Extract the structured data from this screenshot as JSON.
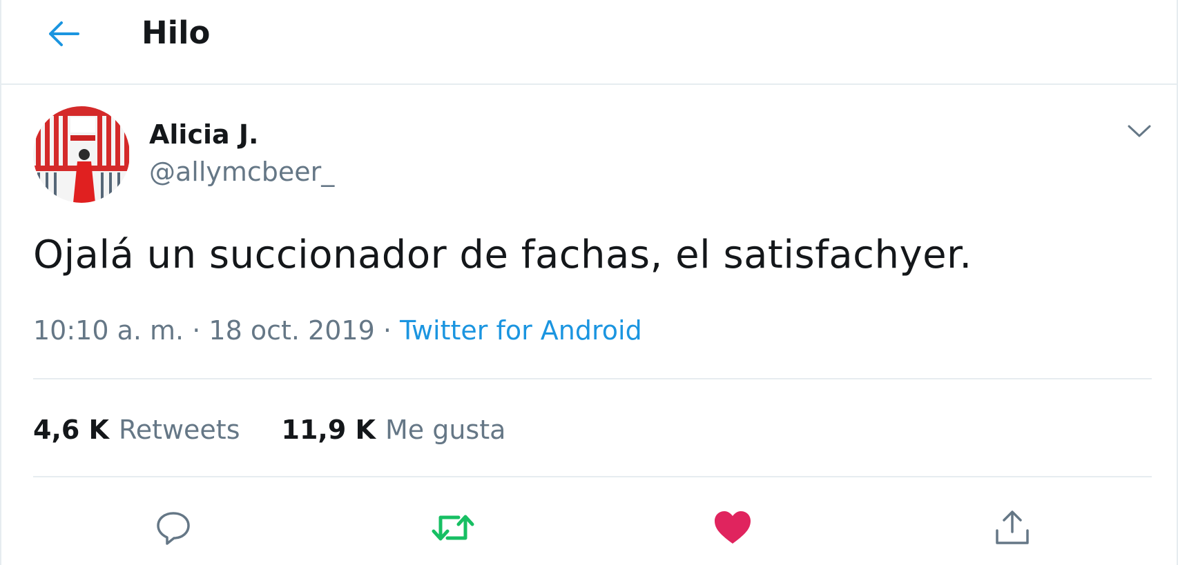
{
  "header": {
    "back_icon": "arrow-left-icon",
    "title": "Hilo"
  },
  "tweet": {
    "author": {
      "name": "Alicia J.",
      "handle": "@allymcbeer_"
    },
    "text": "Ojalá un succionador de fachas, el satisfachyer.",
    "time": "10:10 a. m.",
    "separator": "·",
    "date": "18 oct. 2019",
    "source": "Twitter for Android",
    "stats": {
      "retweets_count": "4,6 K",
      "retweets_label": "Retweets",
      "likes_count": "11,9 K",
      "likes_label": "Me gusta"
    },
    "actions": [
      {
        "name": "reply",
        "icon": "speech-bubble-icon",
        "color": "#657786"
      },
      {
        "name": "retweet",
        "icon": "retweet-icon",
        "color": "#17bf63"
      },
      {
        "name": "like",
        "icon": "heart-icon",
        "color": "#e0245e"
      },
      {
        "name": "share",
        "icon": "share-upload-icon",
        "color": "#657786"
      }
    ]
  },
  "colors": {
    "accent": "#1b95e0",
    "text": "#14171a",
    "secondary": "#657786",
    "border": "#e6ecf0",
    "retweet_active": "#17bf63",
    "like_active": "#e0245e"
  }
}
